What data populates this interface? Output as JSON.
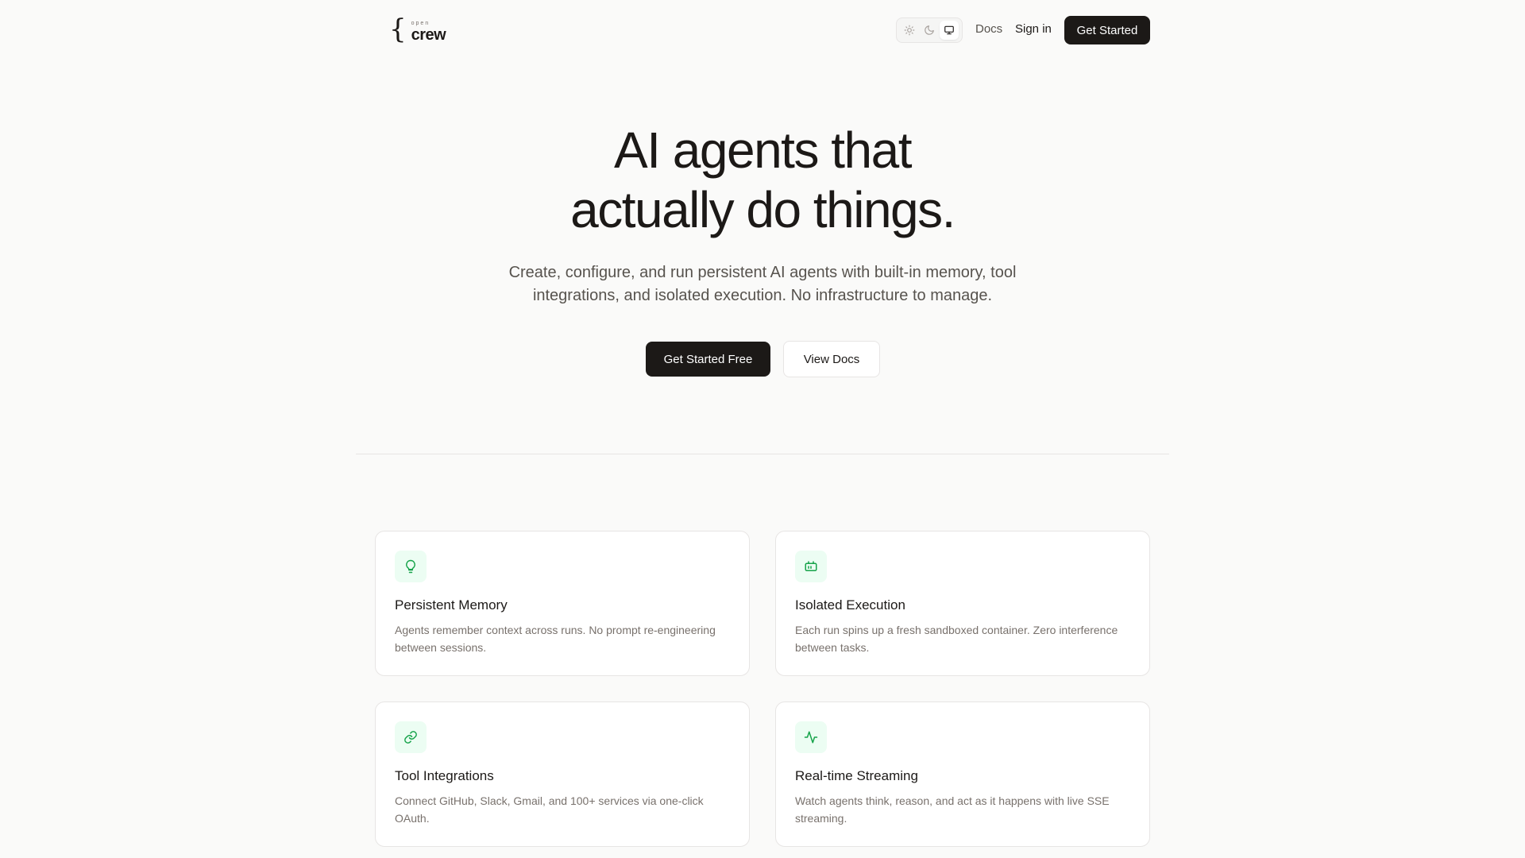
{
  "header": {
    "logo_small": "open",
    "logo_big": "crew",
    "nav": {
      "docs": "Docs",
      "signin": "Sign in",
      "cta": "Get Started"
    },
    "theme_options": [
      "sun-icon",
      "moon-icon",
      "monitor-icon"
    ],
    "theme_selected": "monitor-icon"
  },
  "hero": {
    "title_line1": "AI agents that",
    "title_line2": "actually do things.",
    "subtitle": "Create, configure, and run persistent AI agents with built-in memory, tool integrations, and isolated execution. No infrastructure to manage.",
    "primary_cta": "Get Started Free",
    "secondary_cta": "View Docs"
  },
  "features": [
    {
      "icon": "lightbulb-icon",
      "title": "Persistent Memory",
      "description": "Agents remember context across runs. No prompt re-engineering between sessions."
    },
    {
      "icon": "container-icon",
      "title": "Isolated Execution",
      "description": "Each run spins up a fresh sandboxed container. Zero interference between tasks."
    },
    {
      "icon": "link-icon",
      "title": "Tool Integrations",
      "description": "Connect GitHub, Slack, Gmail, and 100+ services via one-click OAuth."
    },
    {
      "icon": "activity-icon",
      "title": "Real-time Streaming",
      "description": "Watch agents think, reason, and act as it happens with live SSE streaming."
    }
  ],
  "colors": {
    "background": "#fafaf9",
    "text_primary": "#1c1917",
    "text_secondary": "#57534e",
    "accent_green": "#16a34a",
    "icon_bg": "#ecfdf3"
  }
}
